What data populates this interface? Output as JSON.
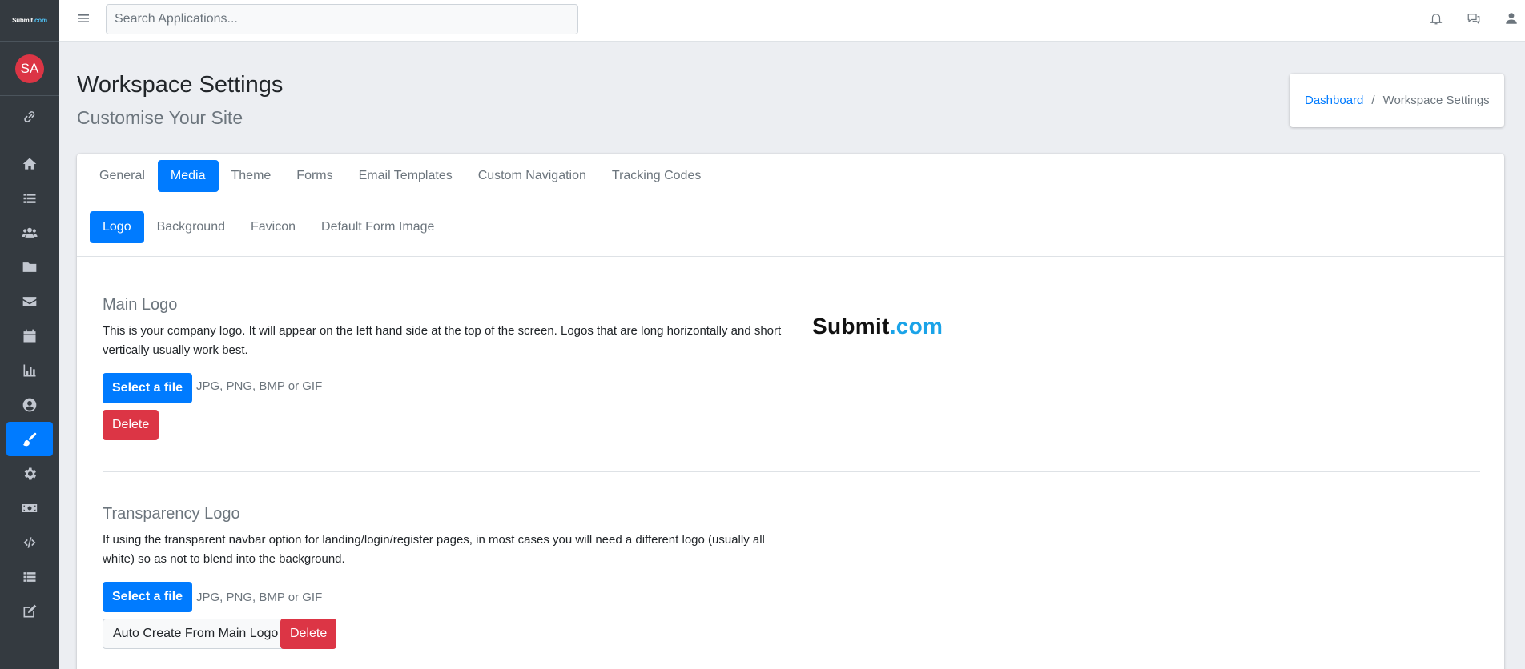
{
  "sidebar": {
    "brand": "Submit",
    "brand_suffix": ".com",
    "avatar": "SA",
    "link_icon": "link-icon",
    "items": [
      {
        "icon": "home-icon",
        "active": false
      },
      {
        "icon": "list-icon",
        "active": false
      },
      {
        "icon": "users-icon",
        "active": false
      },
      {
        "icon": "folder-icon",
        "active": false
      },
      {
        "icon": "envelope-icon",
        "active": false
      },
      {
        "icon": "calendar-icon",
        "active": false
      },
      {
        "icon": "chart-icon",
        "active": false
      },
      {
        "icon": "user-circle-icon",
        "active": false
      },
      {
        "icon": "paintbrush-icon",
        "active": true
      },
      {
        "icon": "gear-icon",
        "active": false
      },
      {
        "icon": "money-icon",
        "active": false
      },
      {
        "icon": "code-icon",
        "active": false
      },
      {
        "icon": "list-icon",
        "active": false
      },
      {
        "icon": "edit-icon",
        "active": false
      }
    ]
  },
  "topbar": {
    "search_placeholder": "Search Applications...",
    "icons": [
      "bell-icon",
      "chat-icon",
      "user-icon"
    ]
  },
  "header": {
    "title": "Workspace Settings",
    "subtitle": "Customise Your Site",
    "breadcrumb": {
      "link": "Dashboard",
      "separator": "/",
      "current": "Workspace Settings"
    }
  },
  "tabs": [
    "General",
    "Media",
    "Theme",
    "Forms",
    "Email Templates",
    "Custom Navigation",
    "Tracking Codes"
  ],
  "active_tab": "Media",
  "subtabs": [
    "Logo",
    "Background",
    "Favicon",
    "Default Form Image"
  ],
  "active_subtab": "Logo",
  "main_logo": {
    "title": "Main Logo",
    "description": "This is your company logo. It will appear on the left hand side at the top of the screen. Logos that are long horizontally and short vertically usually work best.",
    "select_label": "Select a file",
    "formats": "JPG, PNG, BMP or GIF",
    "delete_label": "Delete",
    "preview_text": "Submit",
    "preview_suffix": ".com"
  },
  "transparency_logo": {
    "title": "Transparency Logo",
    "description": "If using the transparent navbar option for landing/login/register pages, in most cases you will need a different logo (usually all white) so as not to blend into the background.",
    "select_label": "Select a file",
    "formats": "JPG, PNG, BMP or GIF",
    "auto_create_label": "Auto Create From Main Logo",
    "delete_label": "Delete"
  },
  "colors": {
    "primary": "#007bff",
    "danger": "#dc3545",
    "sidebar": "#343a40"
  }
}
